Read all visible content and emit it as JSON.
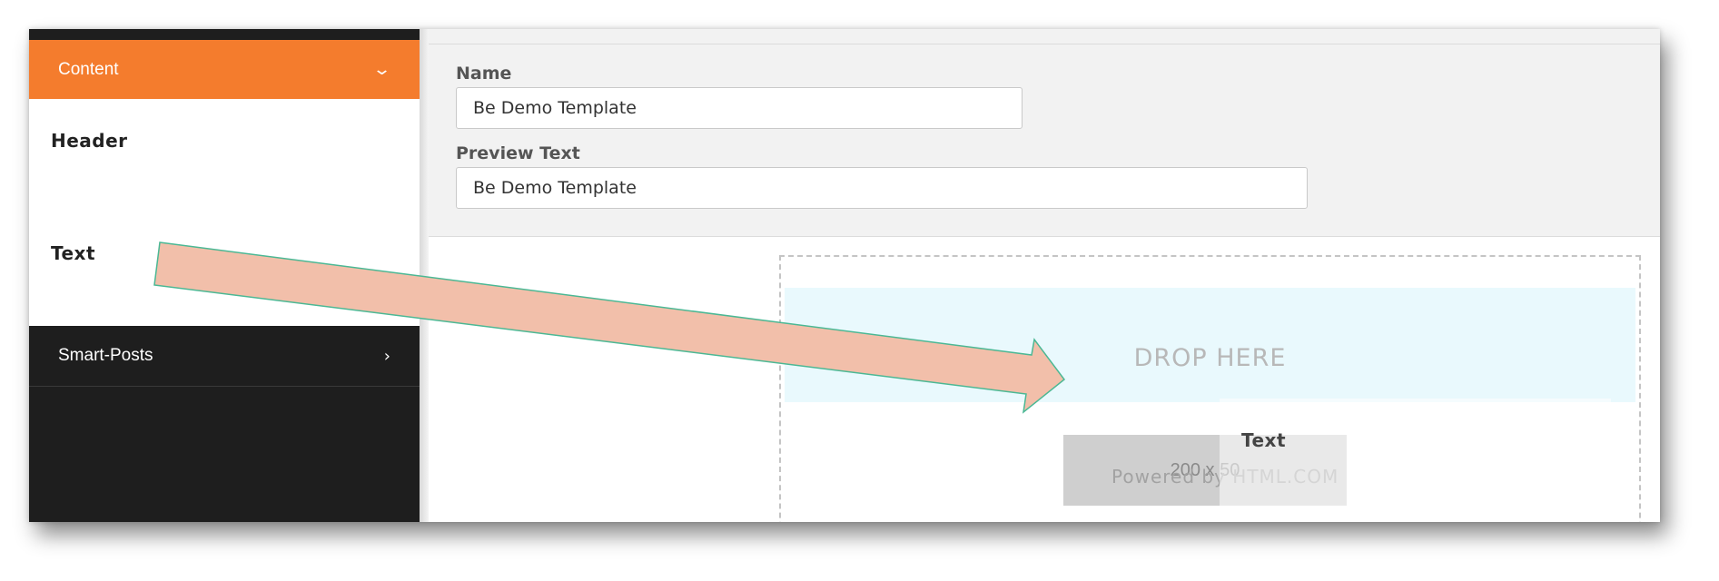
{
  "sidebar": {
    "sections": [
      {
        "label": "Content",
        "icon": "chevron-down-icon",
        "expanded": true,
        "items": [
          {
            "label": "Header"
          },
          {
            "label": "Text"
          }
        ]
      },
      {
        "label": "Smart-Posts",
        "icon": "chevron-right-icon",
        "expanded": false
      }
    ],
    "colors": {
      "active_section": "#f47c2d",
      "dark_bg": "#1e1e1e"
    }
  },
  "settings": {
    "name_label": "Name",
    "name_value": "Be Demo Template",
    "preview_label": "Preview Text",
    "preview_value": "Be Demo Template"
  },
  "canvas": {
    "drop_label": "DROP HERE",
    "image_placeholder": "200 x 50",
    "powered_by": "Powered by HTML.COM",
    "drag_ghost_label": "Text"
  },
  "annotation": {
    "type": "arrow",
    "color": "#f2bfaa",
    "outline": "#4bb894"
  }
}
